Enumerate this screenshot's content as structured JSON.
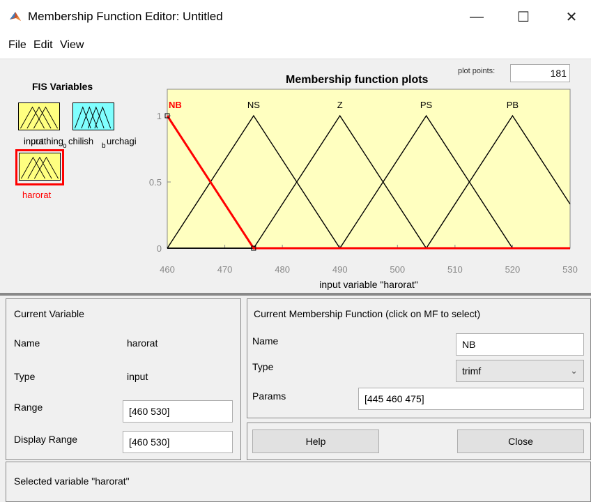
{
  "window": {
    "title": "Membership Function Editor: Untitled",
    "controls": {
      "minimize": "—",
      "maximize": "☐",
      "close": "✕"
    }
  },
  "menu": [
    "File",
    "Edit",
    "View"
  ],
  "fis": {
    "title": "FIS Variables",
    "label_overlap_1": "input",
    "label_overlap_2": "urathing",
    "label_chilish": "chilish",
    "label_sub_o": "o",
    "label_sub_b": "b",
    "label_urchagi": "urchagi",
    "selected_label": "harorat",
    "colors": {
      "input_fill": "#ffff80",
      "output_fill": "#80ffff",
      "selected_border": "#ff0000",
      "selected_text": "#ff0000"
    }
  },
  "plot": {
    "title": "Membership function plots",
    "plot_points_label": "plot points:",
    "plot_points_value": "181",
    "xlabel": "input variable \"harorat\"",
    "background": "#ffffc0"
  },
  "chart_data": {
    "type": "line",
    "title": "Membership function plots",
    "xlabel": "input variable \"harorat\"",
    "ylabel": "",
    "xlim": [
      460,
      530
    ],
    "ylim": [
      0,
      1
    ],
    "x_ticks": [
      "460",
      "470",
      "480",
      "490",
      "500",
      "510",
      "520",
      "530"
    ],
    "y_ticks": [
      "0",
      "0.5",
      "1"
    ],
    "series": [
      {
        "name": "NB",
        "params": [
          445,
          460,
          475
        ],
        "selected": true
      },
      {
        "name": "NS",
        "params": [
          460,
          475,
          490
        ],
        "selected": false
      },
      {
        "name": "Z",
        "params": [
          475,
          490,
          505
        ],
        "selected": false
      },
      {
        "name": "PS",
        "params": [
          490,
          505,
          520
        ],
        "selected": false
      },
      {
        "name": "PB",
        "params": [
          505,
          520,
          535
        ],
        "selected": false
      }
    ],
    "colors": {
      "selected": "#ff0000",
      "normal": "#000000"
    }
  },
  "current_variable": {
    "title": "Current Variable",
    "name_label": "Name",
    "name_value": "harorat",
    "type_label": "Type",
    "type_value": "input",
    "range_label": "Range",
    "range_value": "[460 530]",
    "display_range_label": "Display Range",
    "display_range_value": "[460 530]"
  },
  "current_mf": {
    "title": "Current Membership Function (click on MF to select)",
    "name_label": "Name",
    "name_value": "NB",
    "type_label": "Type",
    "type_value": "trimf",
    "params_label": "Params",
    "params_value": "[445 460 475]"
  },
  "buttons": {
    "help": "Help",
    "close": "Close"
  },
  "status": "Selected variable \"harorat\""
}
